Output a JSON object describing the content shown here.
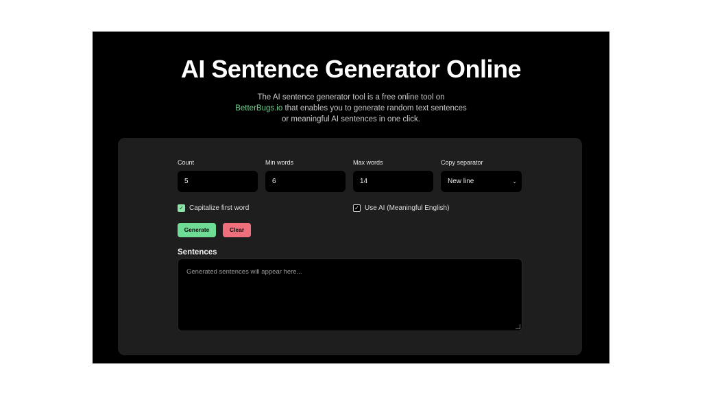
{
  "header": {
    "title": "AI Sentence Generator Online",
    "desc_line1": "The AI sentence generator tool is a free online tool on",
    "desc_link": "BetterBugs.io",
    "desc_line2_rest": " that enables you to generate random text sentences",
    "desc_line3": "or meaningful AI sentences in one click."
  },
  "form": {
    "count": {
      "label": "Count",
      "value": "5"
    },
    "min_words": {
      "label": "Min words",
      "value": "6"
    },
    "max_words": {
      "label": "Max words",
      "value": "14"
    },
    "separator": {
      "label": "Copy separator",
      "value": "New line"
    },
    "capitalize": {
      "label": "Capitalize first word",
      "checked": true
    },
    "use_ai": {
      "label": "Use AI (Meaningful English)",
      "checked": true
    },
    "generate_label": "Generate",
    "clear_label": "Clear"
  },
  "output": {
    "title": "Sentences",
    "placeholder": "Generated sentences will appear here..."
  },
  "colors": {
    "accent_green": "#6fdc95",
    "accent_red": "#ef6f7d",
    "link": "#6fd38f"
  }
}
